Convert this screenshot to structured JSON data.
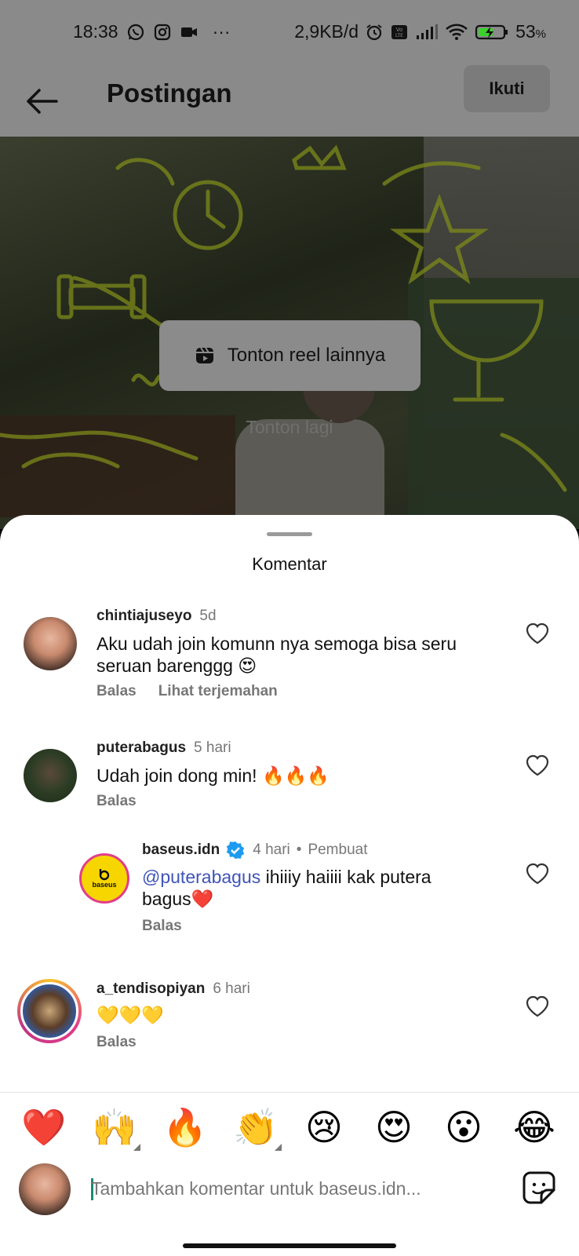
{
  "status_bar": {
    "time": "18:38",
    "network_speed": "2,9KB/d",
    "battery": "53",
    "battery_unit": "%",
    "more": "···",
    "icons": [
      "whatsapp-icon",
      "instagram-icon",
      "video-camera-icon",
      "alarm-icon",
      "volte-icon",
      "signal-icon",
      "wifi-icon",
      "battery-charging-icon"
    ]
  },
  "app_bar": {
    "title": "Postingan",
    "follow_label": "Ikuti",
    "back_icon": "arrow-left-icon"
  },
  "video": {
    "reels_button_label": "Tonton reel lainnya",
    "reels_icon": "reels-icon",
    "replay_label": "Tonton lagi"
  },
  "comments_sheet": {
    "title": "Komentar",
    "comments": [
      {
        "username": "chintiajuseyo",
        "time": "5d",
        "text": "Aku udah join komunn nya semoga bisa seru seruan barenggg 😍",
        "reply_label": "Balas",
        "translate_label": "Lihat terjemahan"
      },
      {
        "username": "puterabagus",
        "time": "5 hari",
        "text": "Udah join dong min! 🔥🔥🔥",
        "reply_label": "Balas"
      },
      {
        "username": "baseus.idn",
        "verified": true,
        "time": "4 hari",
        "creator_label": "Pembuat",
        "mention": "@puterabagus",
        "text": " ihiiiy haiiii kak putera bagus❤️",
        "reply_label": "Balas",
        "avatar_text": "baseus"
      },
      {
        "username": "a_tendisopiyan",
        "time": "6 hari",
        "text": "💛💛💛",
        "reply_label": "Balas"
      }
    ]
  },
  "emoji_bar": [
    "❤️",
    "🙌",
    "🔥",
    "👏",
    "😢",
    "😍",
    "😮",
    "😂"
  ],
  "input": {
    "placeholder": "Tambahkan komentar untuk baseus.idn..."
  },
  "colors": {
    "accent_mention": "#3f54b8",
    "overlay_gray": "#8a8a8a",
    "verified_blue": "#1d9bf0"
  }
}
